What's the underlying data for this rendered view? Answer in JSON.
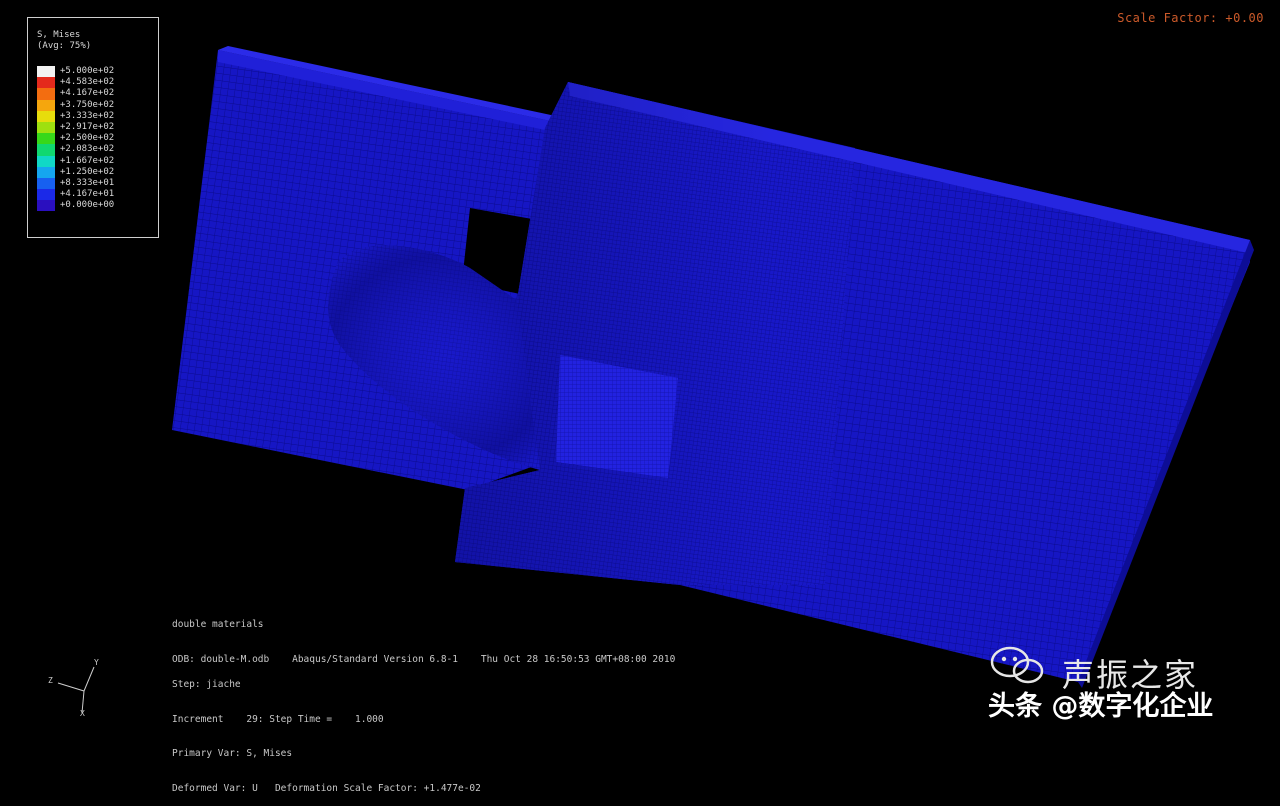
{
  "legend": {
    "title_line1": "S, Mises",
    "title_line2": "(Avg: 75%)",
    "entries": [
      {
        "label": "+5.000e+02",
        "color": "#f2f2f2"
      },
      {
        "label": "+4.583e+02",
        "color": "#e4291c"
      },
      {
        "label": "+4.167e+02",
        "color": "#f36d10"
      },
      {
        "label": "+3.750e+02",
        "color": "#f5a60d"
      },
      {
        "label": "+3.333e+02",
        "color": "#e7dd0c"
      },
      {
        "label": "+2.917e+02",
        "color": "#9fe00f"
      },
      {
        "label": "+2.500e+02",
        "color": "#37d81a"
      },
      {
        "label": "+2.083e+02",
        "color": "#10d870"
      },
      {
        "label": "+1.667e+02",
        "color": "#10d8c6"
      },
      {
        "label": "+1.250e+02",
        "color": "#15a6ef"
      },
      {
        "label": "+8.333e+01",
        "color": "#1760f0"
      },
      {
        "label": "+4.167e+01",
        "color": "#1b29e8"
      },
      {
        "label": "+0.000e+00",
        "color": "#2a0fbf"
      }
    ]
  },
  "scale_factor": "Scale Factor: +0.00",
  "job_info": {
    "line1": "double materials",
    "line2": "ODB: double-M.odb    Abaqus/Standard Version 6.8-1    Thu Oct 28 16:50:53 GMT+08:00 2010"
  },
  "step_info": {
    "line1": "Step: jiache",
    "line2": "Increment    29: Step Time =    1.000",
    "line3": "Primary Var: S, Mises",
    "line4": "Deformed Var: U   Deformation Scale Factor: +1.477e-02"
  },
  "triad": {
    "y": "Y",
    "z": "Z",
    "x": "X"
  },
  "watermark": {
    "brand": "声振之家",
    "line": "头条 @数字化企业"
  },
  "colors": {
    "mesh_blue": "#1515c8",
    "background": "#000000",
    "scale_text": "#cc5a2a"
  }
}
